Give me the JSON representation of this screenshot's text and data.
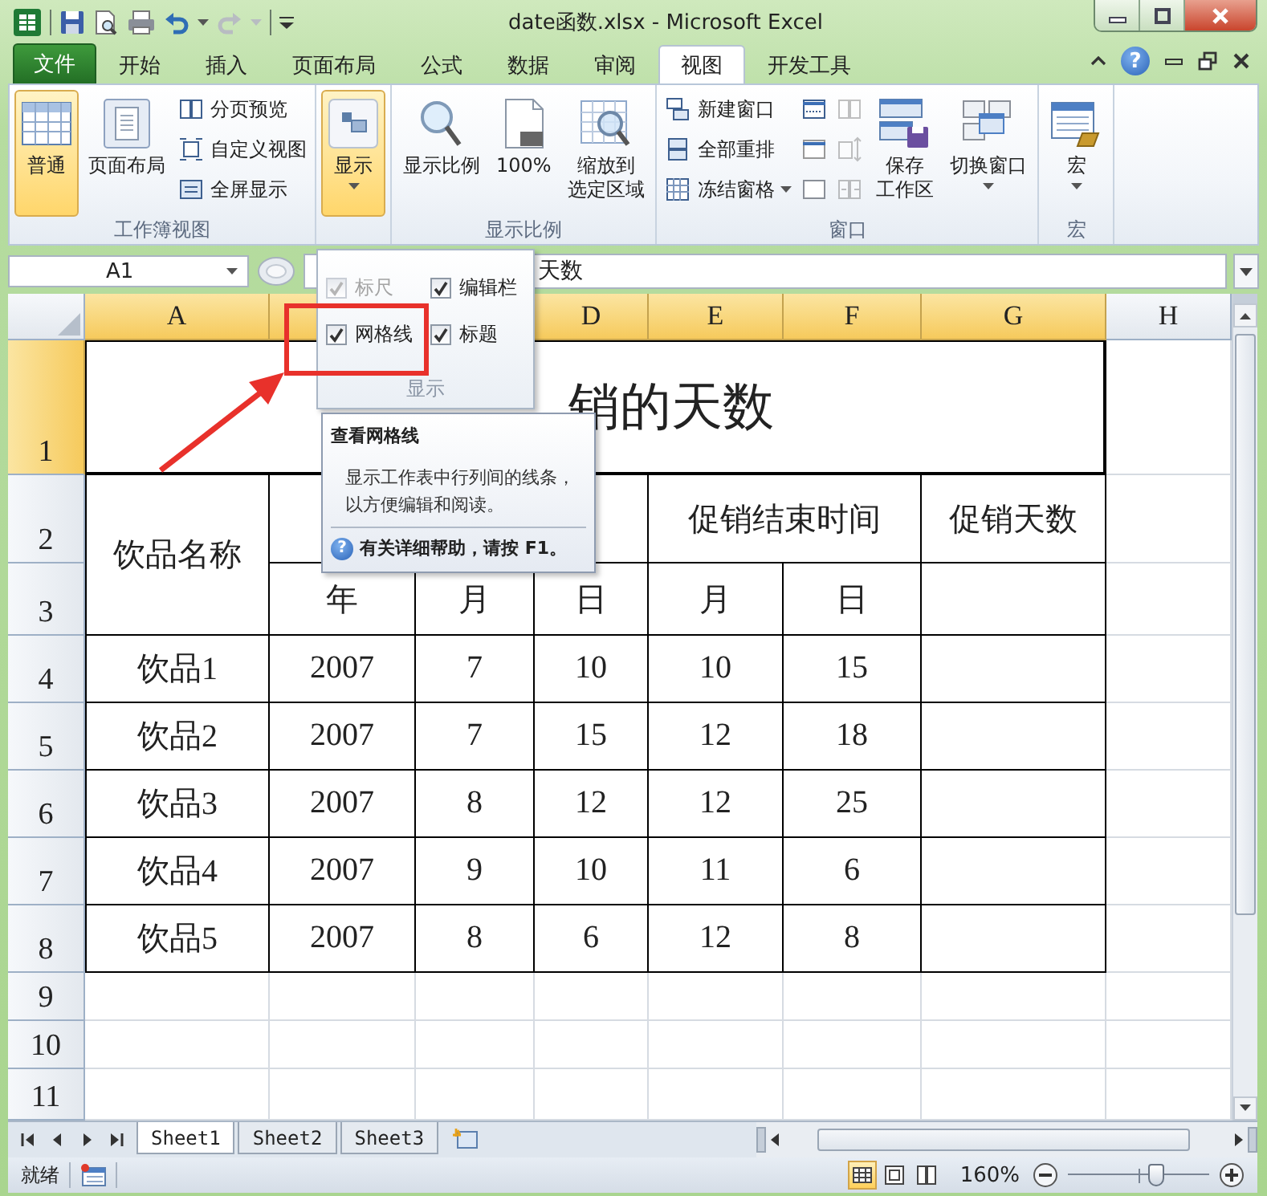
{
  "title_bar": {
    "title": "date函数.xlsx - Microsoft Excel"
  },
  "ribbon_tabs": [
    {
      "label": "文件",
      "kind": "file",
      "selected": false
    },
    {
      "label": "开始",
      "kind": "tab",
      "selected": false
    },
    {
      "label": "插入",
      "kind": "tab",
      "selected": false
    },
    {
      "label": "页面布局",
      "kind": "tab",
      "selected": false
    },
    {
      "label": "公式",
      "kind": "tab",
      "selected": false
    },
    {
      "label": "数据",
      "kind": "tab",
      "selected": false
    },
    {
      "label": "审阅",
      "kind": "tab",
      "selected": false
    },
    {
      "label": "视图",
      "kind": "tab",
      "selected": true
    },
    {
      "label": "开发工具",
      "kind": "tab",
      "selected": false
    }
  ],
  "help_button": {
    "label": "?"
  },
  "ribbon_groups": [
    {
      "label": "工作簿视图",
      "columns": [
        {
          "kind": "large",
          "label": "普通",
          "selected": true,
          "dropdown": false
        },
        {
          "kind": "large",
          "label": "页面布局",
          "selected": false,
          "dropdown": false
        },
        {
          "kind": "stack",
          "items": [
            {
              "label": "分页预览",
              "disabled": false,
              "dropdown": false
            },
            {
              "label": "自定义视图",
              "disabled": false,
              "dropdown": false
            },
            {
              "label": "全屏显示",
              "disabled": false,
              "dropdown": false
            }
          ]
        }
      ]
    },
    {
      "columns": [
        {
          "kind": "large",
          "label": "显示",
          "selected": true,
          "dropdown": true
        }
      ]
    },
    {
      "label": "显示比例",
      "columns": [
        {
          "kind": "large",
          "label": "显示比例",
          "selected": false,
          "dropdown": false
        },
        {
          "kind": "large",
          "label": "100%",
          "selected": false,
          "dropdown": false
        },
        {
          "kind": "large",
          "label": [
            "缩放到",
            "选定区域"
          ],
          "selected": false,
          "dropdown": false
        }
      ]
    },
    {
      "label": "窗口",
      "columns": [
        {
          "kind": "stack",
          "items": [
            {
              "label": "新建窗口",
              "disabled": false,
              "dropdown": false
            },
            {
              "label": "全部重排",
              "disabled": false,
              "dropdown": false
            },
            {
              "label": "冻结窗格",
              "disabled": false,
              "dropdown": true
            }
          ]
        },
        {
          "kind": "stack",
          "items": [
            {
              "disabled": false
            },
            {
              "disabled": false
            },
            {
              "disabled": false
            }
          ]
        },
        {
          "kind": "stack",
          "items": [
            {
              "disabled": true
            },
            {
              "disabled": true
            },
            {
              "disabled": true
            }
          ]
        },
        {
          "kind": "large",
          "label": [
            "保存",
            "工作区"
          ],
          "selected": false,
          "dropdown": false
        },
        {
          "kind": "large",
          "label": "切换窗口",
          "selected": false,
          "dropdown": true
        }
      ]
    },
    {
      "label": "宏",
      "columns": [
        {
          "kind": "large",
          "label": "宏",
          "selected": false,
          "dropdown": true
        }
      ]
    }
  ],
  "name_box": {
    "value": "A1"
  },
  "formula_bar": {
    "value": "天数"
  },
  "sheet": {
    "columns": [
      {
        "label": "A",
        "highlighted": true
      },
      {
        "highlighted": true
      },
      {},
      {
        "label": "D",
        "highlighted": true
      },
      {
        "label": "E",
        "highlighted": true
      },
      {
        "label": "F",
        "highlighted": true
      },
      {
        "label": "G",
        "highlighted": true
      },
      {
        "label": "H",
        "highlighted": false
      }
    ],
    "rows": [
      {
        "label": "1",
        "highlighted": true
      },
      {
        "label": "2",
        "highlighted": false
      },
      {
        "label": "3",
        "highlighted": false
      },
      {
        "label": "4",
        "highlighted": false
      },
      {
        "label": "5",
        "highlighted": false
      },
      {
        "label": "6",
        "highlighted": false
      },
      {
        "label": "7",
        "highlighted": false
      },
      {
        "label": "8",
        "highlighted": false
      },
      {
        "label": "9",
        "highlighted": false
      },
      {
        "label": "10",
        "highlighted": false
      },
      {
        "label": "11",
        "highlighted": false
      }
    ],
    "table": [
      [
        {
          "kind": "title",
          "text": "销的天数",
          "colspan": 7
        }
      ],
      [
        {
          "kind": "text",
          "text": "饮品名称",
          "rowspan": 2
        },
        {
          "kind": "text",
          "colspan": 3
        },
        {
          "kind": "text",
          "text": "促销结束时间",
          "colspan": 2
        },
        {
          "kind": "text",
          "text": "促销天数"
        }
      ],
      [
        {
          "kind": "text",
          "text": "年"
        },
        {
          "kind": "text",
          "text": "月"
        },
        {
          "kind": "text",
          "text": "日"
        },
        {
          "kind": "text",
          "text": "月"
        },
        {
          "kind": "text",
          "text": "日"
        },
        {
          "kind": "text"
        }
      ],
      [
        {
          "kind": "text",
          "text": "饮品1"
        },
        {
          "kind": "text",
          "text": "2007"
        },
        {
          "kind": "text",
          "text": "7"
        },
        {
          "kind": "text",
          "text": "10"
        },
        {
          "kind": "text",
          "text": "10"
        },
        {
          "kind": "text",
          "text": "15"
        },
        {
          "kind": "text"
        }
      ],
      [
        {
          "kind": "text",
          "text": "饮品2"
        },
        {
          "kind": "text",
          "text": "2007"
        },
        {
          "kind": "text",
          "text": "7"
        },
        {
          "kind": "text",
          "text": "15"
        },
        {
          "kind": "text",
          "text": "12"
        },
        {
          "kind": "text",
          "text": "18"
        },
        {
          "kind": "text"
        }
      ],
      [
        {
          "kind": "text",
          "text": "饮品3"
        },
        {
          "kind": "text",
          "text": "2007"
        },
        {
          "kind": "text",
          "text": "8"
        },
        {
          "kind": "text",
          "text": "12"
        },
        {
          "kind": "text",
          "text": "12"
        },
        {
          "kind": "text",
          "text": "25"
        },
        {
          "kind": "text"
        }
      ],
      [
        {
          "kind": "text",
          "text": "饮品4"
        },
        {
          "kind": "text",
          "text": "2007"
        },
        {
          "kind": "text",
          "text": "9"
        },
        {
          "kind": "text",
          "text": "10"
        },
        {
          "kind": "text",
          "text": "11"
        },
        {
          "kind": "text",
          "text": "6"
        },
        {
          "kind": "text"
        }
      ],
      [
        {
          "kind": "text",
          "text": "饮品5"
        },
        {
          "kind": "text",
          "text": "2007"
        },
        {
          "kind": "text",
          "text": "8"
        },
        {
          "kind": "text",
          "text": "6"
        },
        {
          "kind": "text",
          "text": "12"
        },
        {
          "kind": "text",
          "text": "8"
        },
        {
          "kind": "text"
        }
      ]
    ]
  },
  "display_menu": {
    "label": "显示",
    "options": [
      {
        "label": "标尺",
        "checked": true,
        "disabled": true
      },
      {
        "label": "编辑栏",
        "checked": true,
        "disabled": false
      },
      {
        "label": "网格线",
        "checked": true,
        "disabled": false
      },
      {
        "label": "标题",
        "checked": true,
        "disabled": false
      }
    ]
  },
  "tooltip": {
    "title": "查看网格线",
    "body": "显示工作表中行列间的线条，以方便编辑和阅读。",
    "help_icon": "?",
    "help": "有关详细帮助，请按 F1。"
  },
  "sheet_tabs": [
    {
      "label": "Sheet1",
      "selected": true
    },
    {
      "label": "Sheet2",
      "selected": false
    },
    {
      "label": "Sheet3",
      "selected": false
    }
  ],
  "status_bar": {
    "status": "就绪",
    "views": [
      {
        "selected": true
      },
      {
        "selected": false
      },
      {
        "selected": false
      }
    ],
    "zoom": "160%",
    "zoom_slider": {
      "level": 0.63
    }
  }
}
